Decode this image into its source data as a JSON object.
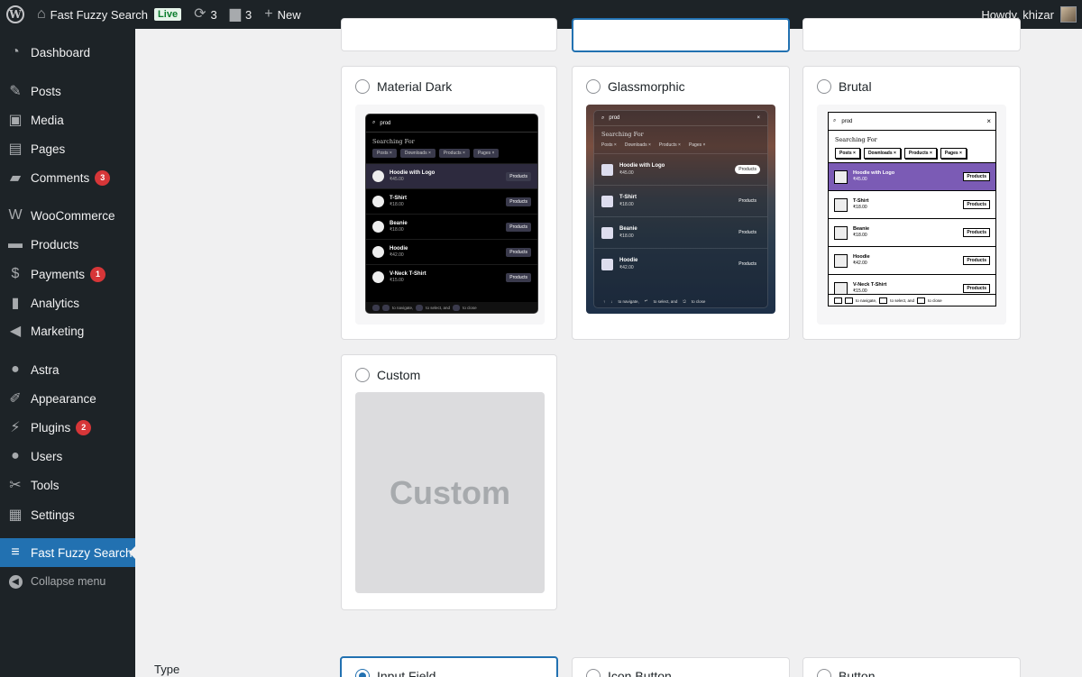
{
  "admin_bar": {
    "site_name": "Fast Fuzzy Search",
    "live_badge": "Live",
    "updates_count": "3",
    "comments_count": "3",
    "new_label": "New",
    "howdy": "Howdy, khizar"
  },
  "sidebar": {
    "items": [
      {
        "label": "Dashboard",
        "icon": "dashboard-icon"
      },
      {
        "label": "Posts",
        "icon": "pin-icon"
      },
      {
        "label": "Media",
        "icon": "media-icon"
      },
      {
        "label": "Pages",
        "icon": "pages-icon"
      },
      {
        "label": "Comments",
        "icon": "comment-icon",
        "badge": "3"
      },
      {
        "label": "WooCommerce",
        "icon": "woo-icon"
      },
      {
        "label": "Products",
        "icon": "archive-icon"
      },
      {
        "label": "Payments",
        "icon": "dollar-icon",
        "badge": "1"
      },
      {
        "label": "Analytics",
        "icon": "chart-icon"
      },
      {
        "label": "Marketing",
        "icon": "megaphone-icon"
      },
      {
        "label": "Astra",
        "icon": "astra-icon"
      },
      {
        "label": "Appearance",
        "icon": "brush-icon"
      },
      {
        "label": "Plugins",
        "icon": "plug-icon",
        "badge": "2"
      },
      {
        "label": "Users",
        "icon": "user-icon"
      },
      {
        "label": "Tools",
        "icon": "wrench-icon"
      },
      {
        "label": "Settings",
        "icon": "sliders-icon"
      },
      {
        "label": "Fast Fuzzy Search",
        "icon": "ffs-icon",
        "active": true
      },
      {
        "label": "Collapse menu",
        "icon": "collapse-icon"
      }
    ]
  },
  "themes": {
    "material_dark": {
      "label": "Material Dark",
      "query": "prod",
      "searching_for": "Searching For",
      "chips": [
        "Posts",
        "Downloads",
        "Products",
        "Pages"
      ],
      "rows": [
        {
          "name": "Hoodie with Logo",
          "price": "₹45.00",
          "tag": "Products"
        },
        {
          "name": "T-Shirt",
          "price": "₹18.00",
          "tag": "Products"
        },
        {
          "name": "Beanie",
          "price": "₹18.00",
          "tag": "Products"
        },
        {
          "name": "Hoodie",
          "price": "₹42.00",
          "tag": "Products"
        },
        {
          "name": "V-Neck T-Shirt",
          "price": "₹15.00",
          "tag": "Products"
        }
      ],
      "footer": {
        "navigate": "to navigate,",
        "select": "to select, and",
        "close": "to close"
      }
    },
    "glassmorphic": {
      "label": "Glassmorphic",
      "query": "prod",
      "searching_for": "Searching For",
      "chips": [
        "Posts",
        "Downloads",
        "Products",
        "Pages"
      ],
      "rows": [
        {
          "name": "Hoodie with Logo",
          "price": "₹45.00",
          "tag": "Products"
        },
        {
          "name": "T-Shirt",
          "price": "₹18.00",
          "tag": "Products"
        },
        {
          "name": "Beanie",
          "price": "₹18.00",
          "tag": "Products"
        },
        {
          "name": "Hoodie",
          "price": "₹42.00",
          "tag": "Products"
        }
      ],
      "footer": {
        "navigate": "to navigate,",
        "select": "to select, and",
        "close": "to close"
      }
    },
    "brutal": {
      "label": "Brutal",
      "query": "prod",
      "searching_for": "Searching For",
      "chips": [
        "Posts",
        "Downloads",
        "Products",
        "Pages"
      ],
      "rows": [
        {
          "name": "Hoodie with Logo",
          "price": "₹45.00",
          "tag": "Products"
        },
        {
          "name": "T-Shirt",
          "price": "₹18.00",
          "tag": "Products"
        },
        {
          "name": "Beanie",
          "price": "₹18.00",
          "tag": "Products"
        },
        {
          "name": "Hoodie",
          "price": "₹42.00",
          "tag": "Products"
        },
        {
          "name": "V-Neck T-Shirt",
          "price": "₹15.00",
          "tag": "Products"
        }
      ],
      "footer": {
        "navigate": "to navigate,",
        "select": "to select, and",
        "close": "to close"
      }
    },
    "custom": {
      "label": "Custom",
      "placeholder": "Custom"
    }
  },
  "type_section": {
    "label": "Type",
    "options": [
      "Input Field",
      "Icon Button",
      "Button"
    ]
  },
  "colors": {
    "admin_dark": "#1d2327",
    "accent": "#2271b1",
    "badge_red": "#d63638",
    "brutal_highlight": "#7b5bb5"
  }
}
